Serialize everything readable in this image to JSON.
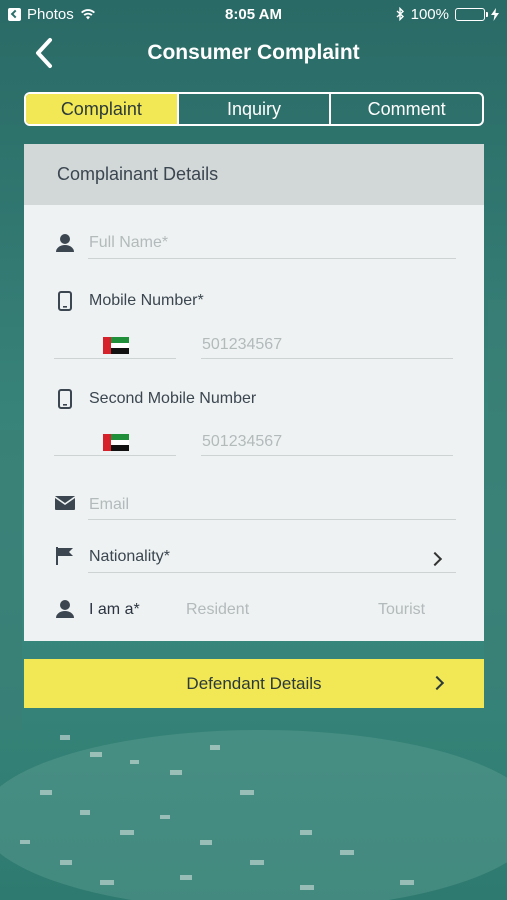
{
  "status_bar": {
    "back_app": "Photos",
    "time": "8:05 AM",
    "battery": "100%"
  },
  "nav": {
    "title": "Consumer Complaint"
  },
  "tabs": [
    {
      "label": "Complaint",
      "active": true
    },
    {
      "label": "Inquiry",
      "active": false
    },
    {
      "label": "Comment",
      "active": false
    }
  ],
  "form": {
    "section_title": "Complainant Details",
    "full_name_placeholder": "Full Name*",
    "mobile_label": "Mobile Number*",
    "mobile_placeholder": "501234567",
    "second_mobile_label": "Second Mobile Number",
    "second_mobile_placeholder": "501234567",
    "email_placeholder": "Email",
    "nationality_label": "Nationality*",
    "i_am_label": "I am a*",
    "resident_option": "Resident",
    "tourist_option": "Tourist"
  },
  "defendant_button": "Defendant Details",
  "colors": {
    "accent_yellow": "#f2e755",
    "teal_bg": "#2c6f6a",
    "card_bg": "#eef2f2",
    "header_bg": "#d2d8d8"
  }
}
